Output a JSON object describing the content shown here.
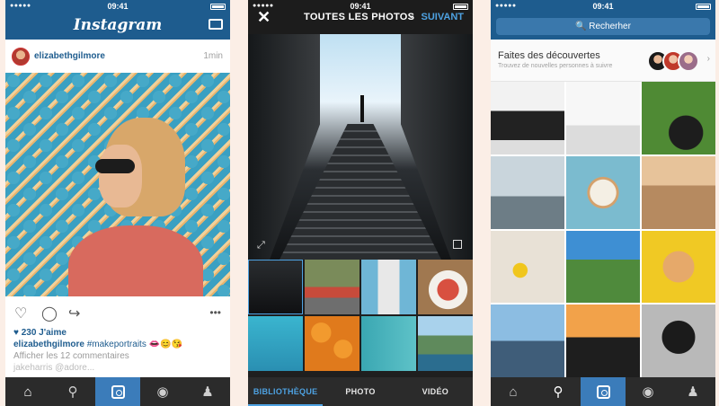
{
  "status": {
    "time": "09:41"
  },
  "feed": {
    "logo": "Instagram",
    "post": {
      "username": "elizabethgilmore",
      "time_ago": "1min",
      "likes": "♥ 230 J'aime",
      "caption_user": "elizabethgilmore",
      "caption_text": "#makeportraits 👄😊😘",
      "comments_link": "Afficher les 12 commentaires",
      "partial_comment": "jakeharris @adore..."
    },
    "icons": [
      "heart-icon",
      "comment-icon",
      "share-icon",
      "more-icon"
    ]
  },
  "camera": {
    "close_label": "✕",
    "title": "TOUTES LES PHOTOS",
    "caret": "⌄",
    "next_label": "SUIVANT",
    "modes": [
      "BIBLIOTHÈQUE",
      "PHOTO",
      "VIDÉO"
    ],
    "selected_mode": "BIBLIOTHÈQUE"
  },
  "explore": {
    "search_placeholder": "🔍 Recherher",
    "discover_title": "Faites des découvertes",
    "discover_sub": "Trouvez de nouvelles personnes à suivre"
  },
  "tabbar": {
    "items": [
      "home-icon",
      "search-icon",
      "camera-icon",
      "activity-icon",
      "profile-icon"
    ]
  },
  "colors": {
    "brand_blue": "#1e5c8e",
    "accent": "#3b7cba",
    "link_blue": "#4ea2e2"
  }
}
